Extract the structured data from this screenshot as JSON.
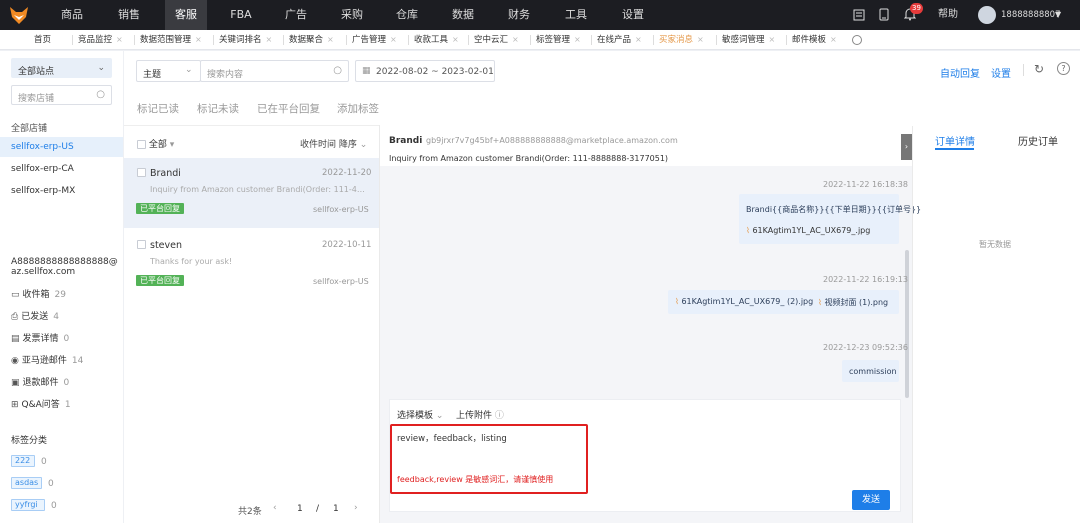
{
  "nav": {
    "items": [
      "商品",
      "销售",
      "客服",
      "FBA",
      "广告",
      "采购",
      "仓库",
      "数据",
      "财务",
      "工具",
      "设置"
    ],
    "active_index": 2,
    "help": "帮助",
    "notif_count": "39",
    "user": "18888888807"
  },
  "tabs": [
    "首页",
    "竞品监控",
    "数据范围管理",
    "关键词排名",
    "数据聚合",
    "广告管理",
    "收款工具",
    "空中云汇",
    "标签管理",
    "在线产品",
    "买家消息",
    "敏感词管理",
    "邮件模板"
  ],
  "active_tab": "买家消息",
  "sidebar": {
    "site_select": "全部站点",
    "store_search_placeholder": "搜索店铺",
    "all_stores": "全部店铺",
    "stores": [
      "sellfox-erp-US",
      "sellfox-erp-CA",
      "sellfox-erp-MX"
    ],
    "account": "A8888888888888888@az.sellfox.com",
    "folders": [
      {
        "label": "收件箱",
        "count": "29"
      },
      {
        "label": "已发送",
        "count": "4"
      },
      {
        "label": "发票详情",
        "count": "0"
      },
      {
        "label": "亚马逊邮件",
        "count": "14"
      },
      {
        "label": "退款邮件",
        "count": "0"
      },
      {
        "label": "Q&A问答",
        "count": "1"
      }
    ],
    "tag_section": "标签分类",
    "tags": [
      {
        "label": "222",
        "count": "0"
      },
      {
        "label": "asdas",
        "count": "0"
      },
      {
        "label": "yyfrgi",
        "count": "0"
      }
    ]
  },
  "toolbar": {
    "subject_select": "主题",
    "search_placeholder": "搜索内容",
    "date_range": "2022-08-02 ~ 2023-02-01",
    "auto_reply": "自动回复",
    "settings": "设置",
    "actions": [
      "标记已读",
      "标记未读",
      "已在平台回复",
      "添加标签"
    ]
  },
  "list": {
    "select_all": "全部",
    "sort": "收件时间 降序",
    "messages": [
      {
        "name": "Brandi",
        "date": "2022-11-20",
        "preview": "Inquiry from Amazon customer Brandi(Order: 111-4625...",
        "status": "已平台回复",
        "store": "sellfox-erp-US"
      },
      {
        "name": "steven",
        "date": "2022-10-11",
        "preview": "Thanks for your ask!",
        "status": "已平台回复",
        "store": "sellfox-erp-US"
      }
    ],
    "pagination": {
      "total": "共2条",
      "current": "1",
      "sep": "/",
      "pages": "1"
    }
  },
  "chat": {
    "sender": "Brandi",
    "email": "gb9jrxr7v7g45bf+A088888888888@marketplace.amazon.com",
    "subject": "Inquiry from Amazon customer Brandi(Order: 111-8888888-3177051)",
    "messages": [
      {
        "time": "2022-11-22 16:18:38",
        "text": "Brandi{{商品名称}}{{下单日期}}{{订单号}}",
        "attach": "61KAgtim1YL_AC_UX679_.jpg"
      },
      {
        "time": "2022-11-22 16:19:13",
        "attach1": "61KAgtim1YL_AC_UX679_ (2).jpg",
        "attach2": "视频封面 (1).png"
      },
      {
        "time": "2022-12-23 09:52:36",
        "text": "commission"
      }
    ],
    "reply": {
      "template": "选择模板",
      "upload": "上传附件",
      "text": "review，feedback，listing",
      "warning": "feedback,review 是敏感词汇，请谨慎使用",
      "send": "发送"
    }
  },
  "right": {
    "tabs": [
      "订单详情",
      "历史订单"
    ],
    "empty": "暂无数据"
  }
}
